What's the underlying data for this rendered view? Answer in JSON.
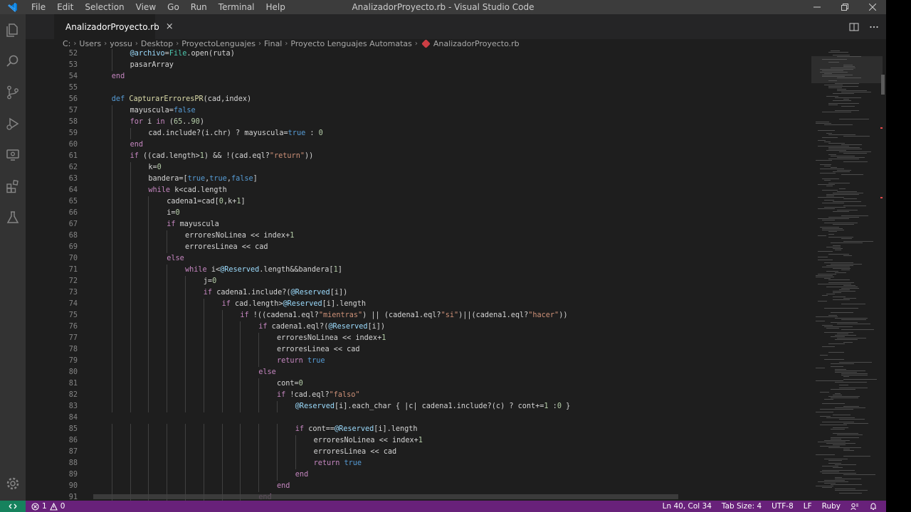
{
  "window": {
    "title": "AnalizadorProyecto.rb - Visual Studio Code"
  },
  "menu": [
    "File",
    "Edit",
    "Selection",
    "View",
    "Go",
    "Run",
    "Terminal",
    "Help"
  ],
  "activity_bar": [
    "explorer-icon",
    "search-icon",
    "source-control-icon",
    "run-debug-icon",
    "remote-explorer-icon",
    "extensions-icon",
    "testing-icon",
    "manage-gear-icon"
  ],
  "tab": {
    "label": "AnalizadorProyecto.rb",
    "close": "×"
  },
  "breadcrumb": [
    "C:",
    "Users",
    "yossu",
    "Desktop",
    "ProyectoLenguajes",
    "Final",
    "Proyecto Lenguajes Automatas",
    "AnalizadorProyecto.rb"
  ],
  "code_lines": [
    {
      "n": "52",
      "indent": 2,
      "t": [
        [
          "@archivo",
          "#9cdcfe"
        ],
        [
          "=",
          "#d4d4d4"
        ],
        [
          "File",
          "#4ec9b0"
        ],
        [
          ".open(ruta)",
          "#d4d4d4"
        ]
      ]
    },
    {
      "n": "53",
      "indent": 2,
      "t": [
        [
          "pasarArray",
          "#d4d4d4"
        ]
      ]
    },
    {
      "n": "54",
      "indent": 1,
      "t": [
        [
          "end",
          "#c586c0"
        ]
      ]
    },
    {
      "n": "55",
      "indent": 0,
      "t": []
    },
    {
      "n": "56",
      "indent": 1,
      "t": [
        [
          "def ",
          "#569cd6"
        ],
        [
          "CapturarErroresPR",
          "#dcdcaa"
        ],
        [
          "(cad,index)",
          "#d4d4d4"
        ]
      ]
    },
    {
      "n": "57",
      "indent": 2,
      "t": [
        [
          "mayuscula",
          "#d4d4d4"
        ],
        [
          "=",
          "#d4d4d4"
        ],
        [
          "false",
          "#569cd6"
        ]
      ]
    },
    {
      "n": "58",
      "indent": 2,
      "t": [
        [
          "for ",
          "#c586c0"
        ],
        [
          "i ",
          "#d4d4d4"
        ],
        [
          "in ",
          "#c586c0"
        ],
        [
          "(",
          "#d4d4d4"
        ],
        [
          "65",
          "#b5cea8"
        ],
        [
          "..",
          "#d4d4d4"
        ],
        [
          "90",
          "#b5cea8"
        ],
        [
          ")",
          "#d4d4d4"
        ]
      ]
    },
    {
      "n": "59",
      "indent": 3,
      "t": [
        [
          "cad.include?(i.chr) ? mayuscula=",
          "#d4d4d4"
        ],
        [
          "true",
          "#569cd6"
        ],
        [
          " : ",
          "#d4d4d4"
        ],
        [
          "0",
          "#b5cea8"
        ]
      ]
    },
    {
      "n": "60",
      "indent": 2,
      "t": [
        [
          "end",
          "#c586c0"
        ]
      ]
    },
    {
      "n": "61",
      "indent": 2,
      "t": [
        [
          "if ",
          "#c586c0"
        ],
        [
          "((cad.length>",
          "#d4d4d4"
        ],
        [
          "1",
          "#b5cea8"
        ],
        [
          ") && !(cad.eql?",
          "#d4d4d4"
        ],
        [
          "\"return\"",
          "#ce9178"
        ],
        [
          "))",
          "#d4d4d4"
        ]
      ]
    },
    {
      "n": "62",
      "indent": 3,
      "t": [
        [
          "k=",
          "#d4d4d4"
        ],
        [
          "0",
          "#b5cea8"
        ]
      ]
    },
    {
      "n": "63",
      "indent": 3,
      "t": [
        [
          "bandera=[",
          "#d4d4d4"
        ],
        [
          "true",
          "#569cd6"
        ],
        [
          ",",
          "#d4d4d4"
        ],
        [
          "true",
          "#569cd6"
        ],
        [
          ",",
          "#d4d4d4"
        ],
        [
          "false",
          "#569cd6"
        ],
        [
          "]",
          "#d4d4d4"
        ]
      ]
    },
    {
      "n": "64",
      "indent": 3,
      "t": [
        [
          "while ",
          "#c586c0"
        ],
        [
          "k<cad.length",
          "#d4d4d4"
        ]
      ]
    },
    {
      "n": "65",
      "indent": 4,
      "t": [
        [
          "cadena1=cad[",
          "#d4d4d4"
        ],
        [
          "0",
          "#b5cea8"
        ],
        [
          ",k+",
          "#d4d4d4"
        ],
        [
          "1",
          "#b5cea8"
        ],
        [
          "]",
          "#d4d4d4"
        ]
      ]
    },
    {
      "n": "66",
      "indent": 4,
      "t": [
        [
          "i=",
          "#d4d4d4"
        ],
        [
          "0",
          "#b5cea8"
        ]
      ]
    },
    {
      "n": "67",
      "indent": 4,
      "t": [
        [
          "if ",
          "#c586c0"
        ],
        [
          "mayuscula",
          "#d4d4d4"
        ]
      ]
    },
    {
      "n": "68",
      "indent": 5,
      "t": [
        [
          "erroresNoLinea << index+",
          "#d4d4d4"
        ],
        [
          "1",
          "#b5cea8"
        ]
      ]
    },
    {
      "n": "69",
      "indent": 5,
      "t": [
        [
          "erroresLinea << cad",
          "#d4d4d4"
        ]
      ]
    },
    {
      "n": "70",
      "indent": 4,
      "t": [
        [
          "else",
          "#c586c0"
        ]
      ]
    },
    {
      "n": "71",
      "indent": 5,
      "t": [
        [
          "while ",
          "#c586c0"
        ],
        [
          "i<",
          "#d4d4d4"
        ],
        [
          "@Reserved",
          "#9cdcfe"
        ],
        [
          ".length&&bandera[",
          "#d4d4d4"
        ],
        [
          "1",
          "#b5cea8"
        ],
        [
          "]",
          "#d4d4d4"
        ]
      ]
    },
    {
      "n": "72",
      "indent": 6,
      "t": [
        [
          "j=",
          "#d4d4d4"
        ],
        [
          "0",
          "#b5cea8"
        ]
      ]
    },
    {
      "n": "73",
      "indent": 6,
      "t": [
        [
          "if ",
          "#c586c0"
        ],
        [
          "cadena1.include?(",
          "#d4d4d4"
        ],
        [
          "@Reserved",
          "#9cdcfe"
        ],
        [
          "[i])",
          "#d4d4d4"
        ]
      ]
    },
    {
      "n": "74",
      "indent": 7,
      "t": [
        [
          "if ",
          "#c586c0"
        ],
        [
          "cad.length>",
          "#d4d4d4"
        ],
        [
          "@Reserved",
          "#9cdcfe"
        ],
        [
          "[i].length",
          "#d4d4d4"
        ]
      ]
    },
    {
      "n": "75",
      "indent": 8,
      "t": [
        [
          "if ",
          "#c586c0"
        ],
        [
          "!((cadena1.eql?",
          "#d4d4d4"
        ],
        [
          "\"mientras\"",
          "#ce9178"
        ],
        [
          ") || (cadena1.eql?",
          "#d4d4d4"
        ],
        [
          "\"si\"",
          "#ce9178"
        ],
        [
          ")||(cadena1.eql?",
          "#d4d4d4"
        ],
        [
          "\"hacer\"",
          "#ce9178"
        ],
        [
          "))",
          "#d4d4d4"
        ]
      ]
    },
    {
      "n": "76",
      "indent": 9,
      "t": [
        [
          "if ",
          "#c586c0"
        ],
        [
          "cadena1.eql?(",
          "#d4d4d4"
        ],
        [
          "@Reserved",
          "#9cdcfe"
        ],
        [
          "[i])",
          "#d4d4d4"
        ]
      ]
    },
    {
      "n": "77",
      "indent": 10,
      "t": [
        [
          "erroresNoLinea << index+",
          "#d4d4d4"
        ],
        [
          "1",
          "#b5cea8"
        ]
      ]
    },
    {
      "n": "78",
      "indent": 10,
      "t": [
        [
          "erroresLinea << cad",
          "#d4d4d4"
        ]
      ]
    },
    {
      "n": "79",
      "indent": 10,
      "t": [
        [
          "return ",
          "#c586c0"
        ],
        [
          "true",
          "#569cd6"
        ]
      ]
    },
    {
      "n": "80",
      "indent": 9,
      "t": [
        [
          "else",
          "#c586c0"
        ]
      ]
    },
    {
      "n": "81",
      "indent": 10,
      "t": [
        [
          "cont=",
          "#d4d4d4"
        ],
        [
          "0",
          "#b5cea8"
        ]
      ]
    },
    {
      "n": "82",
      "indent": 10,
      "t": [
        [
          "if ",
          "#c586c0"
        ],
        [
          "!cad.eql?",
          "#d4d4d4"
        ],
        [
          "\"falso\"",
          "#ce9178"
        ]
      ]
    },
    {
      "n": "83",
      "indent": 11,
      "t": [
        [
          "@Reserved",
          "#9cdcfe"
        ],
        [
          "[i].each_char { |c| cadena1.include?(c) ? cont+=",
          "#d4d4d4"
        ],
        [
          "1",
          "#b5cea8"
        ],
        [
          " :",
          "#d4d4d4"
        ],
        [
          "0",
          "#b5cea8"
        ],
        [
          " }",
          "#d4d4d4"
        ]
      ]
    },
    {
      "n": "84",
      "indent": 0,
      "t": []
    },
    {
      "n": "85",
      "indent": 11,
      "t": [
        [
          "if ",
          "#c586c0"
        ],
        [
          "cont==",
          "#d4d4d4"
        ],
        [
          "@Reserved",
          "#9cdcfe"
        ],
        [
          "[i].length",
          "#d4d4d4"
        ]
      ]
    },
    {
      "n": "86",
      "indent": 12,
      "t": [
        [
          "erroresNoLinea << index+",
          "#d4d4d4"
        ],
        [
          "1",
          "#b5cea8"
        ]
      ]
    },
    {
      "n": "87",
      "indent": 12,
      "t": [
        [
          "erroresLinea << cad",
          "#d4d4d4"
        ]
      ]
    },
    {
      "n": "88",
      "indent": 12,
      "t": [
        [
          "return ",
          "#c586c0"
        ],
        [
          "true",
          "#569cd6"
        ]
      ]
    },
    {
      "n": "89",
      "indent": 11,
      "t": [
        [
          "end",
          "#c586c0"
        ]
      ]
    },
    {
      "n": "90",
      "indent": 10,
      "t": [
        [
          "end",
          "#c586c0"
        ]
      ]
    },
    {
      "n": "91",
      "indent": 9,
      "t": [
        [
          "end",
          "#c586c0"
        ]
      ]
    }
  ],
  "status": {
    "problems": "1",
    "warnings": "0",
    "position": "Ln 40, Col 34",
    "tab_size": "Tab Size: 4",
    "encoding": "UTF-8",
    "eol": "LF",
    "language": "Ruby"
  },
  "colors": {
    "statusbar": "#68217a",
    "activitybar": "#333333",
    "editor_bg": "#1e1e1e"
  }
}
